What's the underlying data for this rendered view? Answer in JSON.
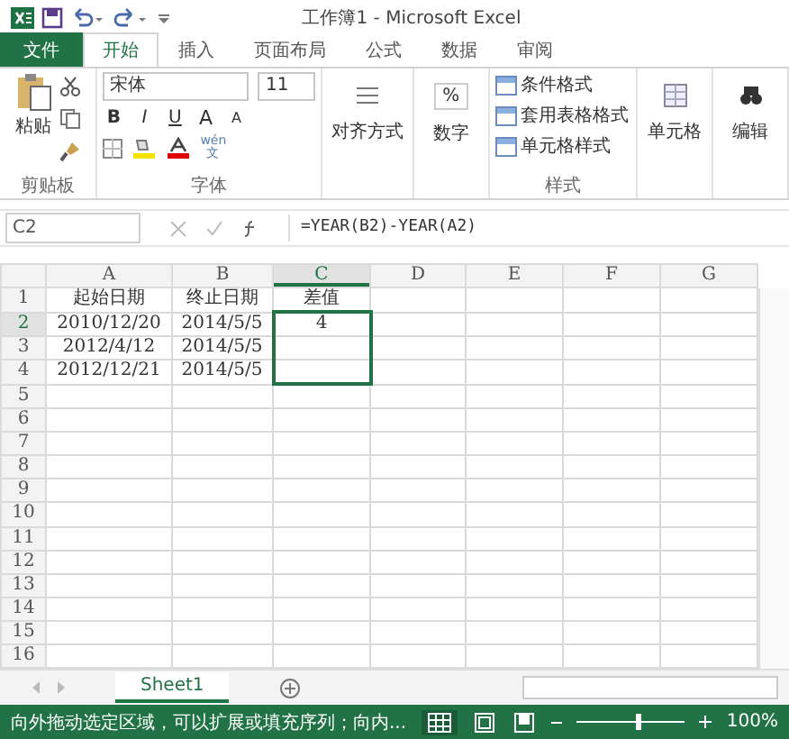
{
  "window": {
    "title": "工作簿1 - Microsoft Excel"
  },
  "tabs": [
    {
      "label": "文件",
      "kind": "file",
      "selected": false
    },
    {
      "label": "开始",
      "kind": "tab",
      "selected": true
    },
    {
      "label": "插入",
      "kind": "tab",
      "selected": false
    },
    {
      "label": "页面布局",
      "kind": "tab",
      "selected": false
    },
    {
      "label": "公式",
      "kind": "tab",
      "selected": false
    },
    {
      "label": "数据",
      "kind": "tab",
      "selected": false
    },
    {
      "label": "审阅",
      "kind": "tab",
      "selected": false
    }
  ],
  "ribbon": {
    "clipboard": {
      "paste": "粘贴",
      "group": "剪贴板"
    },
    "font": {
      "font_name": "宋体",
      "font_size": "11",
      "bold": "B",
      "italic": "I",
      "underline": "U",
      "grow": "A",
      "shrink": "A",
      "phonetic": "wén\n文",
      "group": "字体"
    },
    "alignment": {
      "label": "对齐方式"
    },
    "number": {
      "symbol": "%",
      "label": "数字"
    },
    "styles": {
      "items": [
        "条件格式",
        "套用表格格式",
        "单元格样式"
      ],
      "group": "样式"
    },
    "cells": {
      "label": "单元格"
    },
    "editing": {
      "label": "编辑"
    }
  },
  "formula_bar": {
    "name_box": "C2",
    "formula": "=YEAR(B2)-YEAR(A2)"
  },
  "grid": {
    "columns": [
      {
        "label": "A",
        "selected": false
      },
      {
        "label": "B",
        "selected": false
      },
      {
        "label": "C",
        "selected": true
      },
      {
        "label": "D",
        "selected": false
      },
      {
        "label": "E",
        "selected": false
      },
      {
        "label": "F",
        "selected": false
      },
      {
        "label": "G",
        "selected": false
      }
    ],
    "rows": [
      {
        "number": "1",
        "selected": false,
        "in_selection": false,
        "cells": [
          "起始日期",
          "终止日期",
          "差值",
          "",
          "",
          "",
          ""
        ]
      },
      {
        "number": "2",
        "selected": true,
        "in_selection": true,
        "cells": [
          "2010/12/20",
          "2014/5/5",
          "4",
          "",
          "",
          "",
          ""
        ]
      },
      {
        "number": "3",
        "selected": false,
        "in_selection": true,
        "cells": [
          "2012/4/12",
          "2014/5/5",
          "",
          "",
          "",
          "",
          ""
        ]
      },
      {
        "number": "4",
        "selected": false,
        "in_selection": true,
        "cells": [
          "2012/12/21",
          "2014/5/5",
          "",
          "",
          "",
          "",
          ""
        ]
      },
      {
        "number": "5",
        "selected": false,
        "in_selection": false,
        "cells": [
          "",
          "",
          "",
          "",
          "",
          "",
          ""
        ]
      },
      {
        "number": "6",
        "selected": false,
        "in_selection": false,
        "cells": [
          "",
          "",
          "",
          "",
          "",
          "",
          ""
        ]
      },
      {
        "number": "7",
        "selected": false,
        "in_selection": false,
        "cells": [
          "",
          "",
          "",
          "",
          "",
          "",
          ""
        ]
      },
      {
        "number": "8",
        "selected": false,
        "in_selection": false,
        "cells": [
          "",
          "",
          "",
          "",
          "",
          "",
          ""
        ]
      },
      {
        "number": "9",
        "selected": false,
        "in_selection": false,
        "cells": [
          "",
          "",
          "",
          "",
          "",
          "",
          ""
        ]
      },
      {
        "number": "10",
        "selected": false,
        "in_selection": false,
        "cells": [
          "",
          "",
          "",
          "",
          "",
          "",
          ""
        ]
      },
      {
        "number": "11",
        "selected": false,
        "in_selection": false,
        "cells": [
          "",
          "",
          "",
          "",
          "",
          "",
          ""
        ]
      },
      {
        "number": "12",
        "selected": false,
        "in_selection": false,
        "cells": [
          "",
          "",
          "",
          "",
          "",
          "",
          ""
        ]
      },
      {
        "number": "13",
        "selected": false,
        "in_selection": false,
        "cells": [
          "",
          "",
          "",
          "",
          "",
          "",
          ""
        ]
      },
      {
        "number": "14",
        "selected": false,
        "in_selection": false,
        "cells": [
          "",
          "",
          "",
          "",
          "",
          "",
          ""
        ]
      },
      {
        "number": "15",
        "selected": false,
        "in_selection": false,
        "cells": [
          "",
          "",
          "",
          "",
          "",
          "",
          ""
        ]
      },
      {
        "number": "16",
        "selected": false,
        "in_selection": false,
        "cells": [
          "",
          "",
          "",
          "",
          "",
          "",
          ""
        ]
      }
    ]
  },
  "sheet_tabs": [
    {
      "label": "Sheet1",
      "selected": true
    }
  ],
  "status_bar": {
    "message": "向外拖动选定区域，可以扩展或填充序列；向内...",
    "zoom": "100%",
    "zoom_level": {
      "level": 0.55
    }
  }
}
